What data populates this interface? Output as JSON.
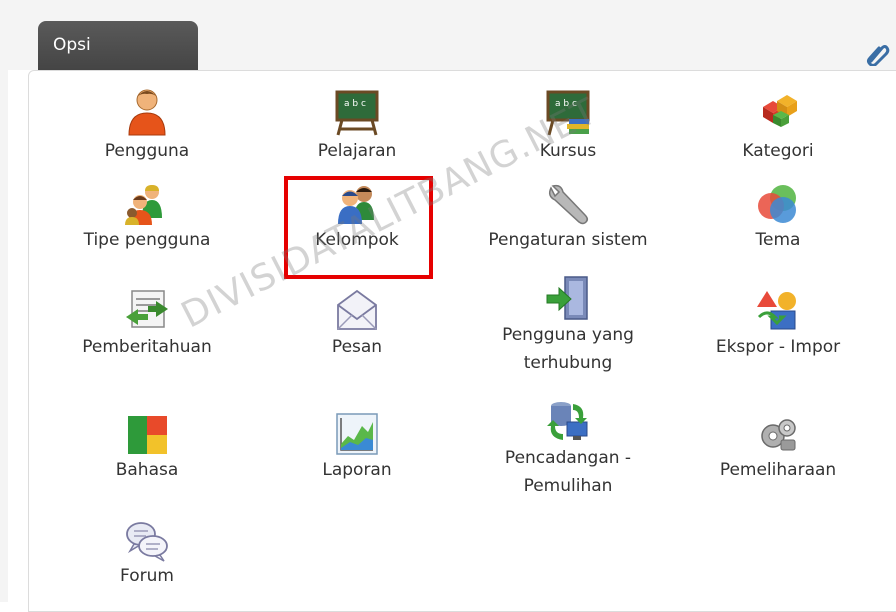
{
  "panel": {
    "title": "Opsi"
  },
  "items": [
    {
      "label": "Pengguna",
      "icon": "user-icon"
    },
    {
      "label": "Pelajaran",
      "icon": "blackboard-icon"
    },
    {
      "label": "Kursus",
      "icon": "blackboard-books-icon"
    },
    {
      "label": "Kategori",
      "icon": "category-cubes-icon"
    },
    {
      "label": "Tipe pengguna",
      "icon": "user-types-icon"
    },
    {
      "label": "Kelompok",
      "icon": "group-icon"
    },
    {
      "label": "Pengaturan sistem",
      "icon": "wrench-icon"
    },
    {
      "label": "Tema",
      "icon": "theme-circles-icon"
    },
    {
      "label": "Pemberitahuan",
      "icon": "notification-icon"
    },
    {
      "label": "Pesan",
      "icon": "envelope-icon"
    },
    {
      "label": "Pengguna yang terhubung",
      "icon": "connected-users-door-icon"
    },
    {
      "label": "Ekspor - Impor",
      "icon": "export-import-icon"
    },
    {
      "label": "Bahasa",
      "icon": "language-flag-icon"
    },
    {
      "label": "Laporan",
      "icon": "report-chart-icon"
    },
    {
      "label": "Pencadangan - Pemulihan",
      "icon": "backup-restore-icon"
    },
    {
      "label": "Pemeliharaan",
      "icon": "maintenance-icon"
    },
    {
      "label": "Forum",
      "icon": "forum-bubbles-icon"
    }
  ],
  "watermark": "DIVISIDATALITBANG.NET",
  "colors": {
    "tab": "#4a4a4a",
    "highlight": "#e60000"
  }
}
